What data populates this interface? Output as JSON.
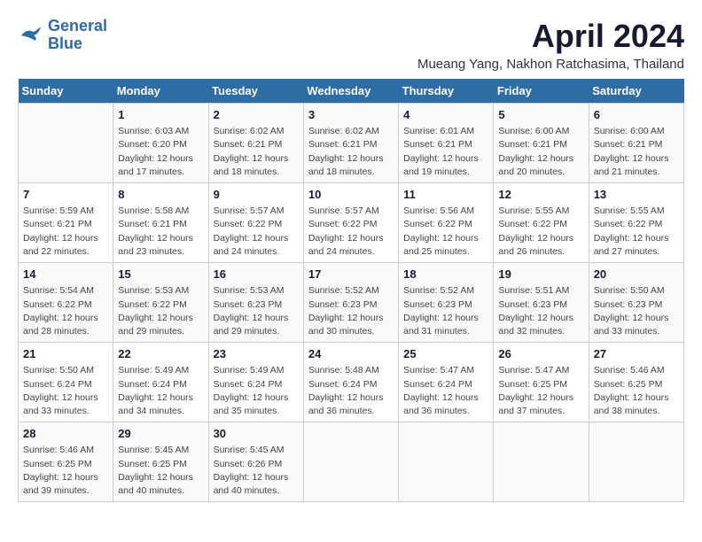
{
  "header": {
    "logo_line1": "General",
    "logo_line2": "Blue",
    "month": "April 2024",
    "location": "Mueang Yang, Nakhon Ratchasima, Thailand"
  },
  "days_of_week": [
    "Sunday",
    "Monday",
    "Tuesday",
    "Wednesday",
    "Thursday",
    "Friday",
    "Saturday"
  ],
  "weeks": [
    [
      {
        "day": "",
        "info": ""
      },
      {
        "day": "1",
        "info": "Sunrise: 6:03 AM\nSunset: 6:20 PM\nDaylight: 12 hours\nand 17 minutes."
      },
      {
        "day": "2",
        "info": "Sunrise: 6:02 AM\nSunset: 6:21 PM\nDaylight: 12 hours\nand 18 minutes."
      },
      {
        "day": "3",
        "info": "Sunrise: 6:02 AM\nSunset: 6:21 PM\nDaylight: 12 hours\nand 18 minutes."
      },
      {
        "day": "4",
        "info": "Sunrise: 6:01 AM\nSunset: 6:21 PM\nDaylight: 12 hours\nand 19 minutes."
      },
      {
        "day": "5",
        "info": "Sunrise: 6:00 AM\nSunset: 6:21 PM\nDaylight: 12 hours\nand 20 minutes."
      },
      {
        "day": "6",
        "info": "Sunrise: 6:00 AM\nSunset: 6:21 PM\nDaylight: 12 hours\nand 21 minutes."
      }
    ],
    [
      {
        "day": "7",
        "info": "Sunrise: 5:59 AM\nSunset: 6:21 PM\nDaylight: 12 hours\nand 22 minutes."
      },
      {
        "day": "8",
        "info": "Sunrise: 5:58 AM\nSunset: 6:21 PM\nDaylight: 12 hours\nand 23 minutes."
      },
      {
        "day": "9",
        "info": "Sunrise: 5:57 AM\nSunset: 6:22 PM\nDaylight: 12 hours\nand 24 minutes."
      },
      {
        "day": "10",
        "info": "Sunrise: 5:57 AM\nSunset: 6:22 PM\nDaylight: 12 hours\nand 24 minutes."
      },
      {
        "day": "11",
        "info": "Sunrise: 5:56 AM\nSunset: 6:22 PM\nDaylight: 12 hours\nand 25 minutes."
      },
      {
        "day": "12",
        "info": "Sunrise: 5:55 AM\nSunset: 6:22 PM\nDaylight: 12 hours\nand 26 minutes."
      },
      {
        "day": "13",
        "info": "Sunrise: 5:55 AM\nSunset: 6:22 PM\nDaylight: 12 hours\nand 27 minutes."
      }
    ],
    [
      {
        "day": "14",
        "info": "Sunrise: 5:54 AM\nSunset: 6:22 PM\nDaylight: 12 hours\nand 28 minutes."
      },
      {
        "day": "15",
        "info": "Sunrise: 5:53 AM\nSunset: 6:22 PM\nDaylight: 12 hours\nand 29 minutes."
      },
      {
        "day": "16",
        "info": "Sunrise: 5:53 AM\nSunset: 6:23 PM\nDaylight: 12 hours\nand 29 minutes."
      },
      {
        "day": "17",
        "info": "Sunrise: 5:52 AM\nSunset: 6:23 PM\nDaylight: 12 hours\nand 30 minutes."
      },
      {
        "day": "18",
        "info": "Sunrise: 5:52 AM\nSunset: 6:23 PM\nDaylight: 12 hours\nand 31 minutes."
      },
      {
        "day": "19",
        "info": "Sunrise: 5:51 AM\nSunset: 6:23 PM\nDaylight: 12 hours\nand 32 minutes."
      },
      {
        "day": "20",
        "info": "Sunrise: 5:50 AM\nSunset: 6:23 PM\nDaylight: 12 hours\nand 33 minutes."
      }
    ],
    [
      {
        "day": "21",
        "info": "Sunrise: 5:50 AM\nSunset: 6:24 PM\nDaylight: 12 hours\nand 33 minutes."
      },
      {
        "day": "22",
        "info": "Sunrise: 5:49 AM\nSunset: 6:24 PM\nDaylight: 12 hours\nand 34 minutes."
      },
      {
        "day": "23",
        "info": "Sunrise: 5:49 AM\nSunset: 6:24 PM\nDaylight: 12 hours\nand 35 minutes."
      },
      {
        "day": "24",
        "info": "Sunrise: 5:48 AM\nSunset: 6:24 PM\nDaylight: 12 hours\nand 36 minutes."
      },
      {
        "day": "25",
        "info": "Sunrise: 5:47 AM\nSunset: 6:24 PM\nDaylight: 12 hours\nand 36 minutes."
      },
      {
        "day": "26",
        "info": "Sunrise: 5:47 AM\nSunset: 6:25 PM\nDaylight: 12 hours\nand 37 minutes."
      },
      {
        "day": "27",
        "info": "Sunrise: 5:46 AM\nSunset: 6:25 PM\nDaylight: 12 hours\nand 38 minutes."
      }
    ],
    [
      {
        "day": "28",
        "info": "Sunrise: 5:46 AM\nSunset: 6:25 PM\nDaylight: 12 hours\nand 39 minutes."
      },
      {
        "day": "29",
        "info": "Sunrise: 5:45 AM\nSunset: 6:25 PM\nDaylight: 12 hours\nand 40 minutes."
      },
      {
        "day": "30",
        "info": "Sunrise: 5:45 AM\nSunset: 6:26 PM\nDaylight: 12 hours\nand 40 minutes."
      },
      {
        "day": "",
        "info": ""
      },
      {
        "day": "",
        "info": ""
      },
      {
        "day": "",
        "info": ""
      },
      {
        "day": "",
        "info": ""
      }
    ]
  ]
}
